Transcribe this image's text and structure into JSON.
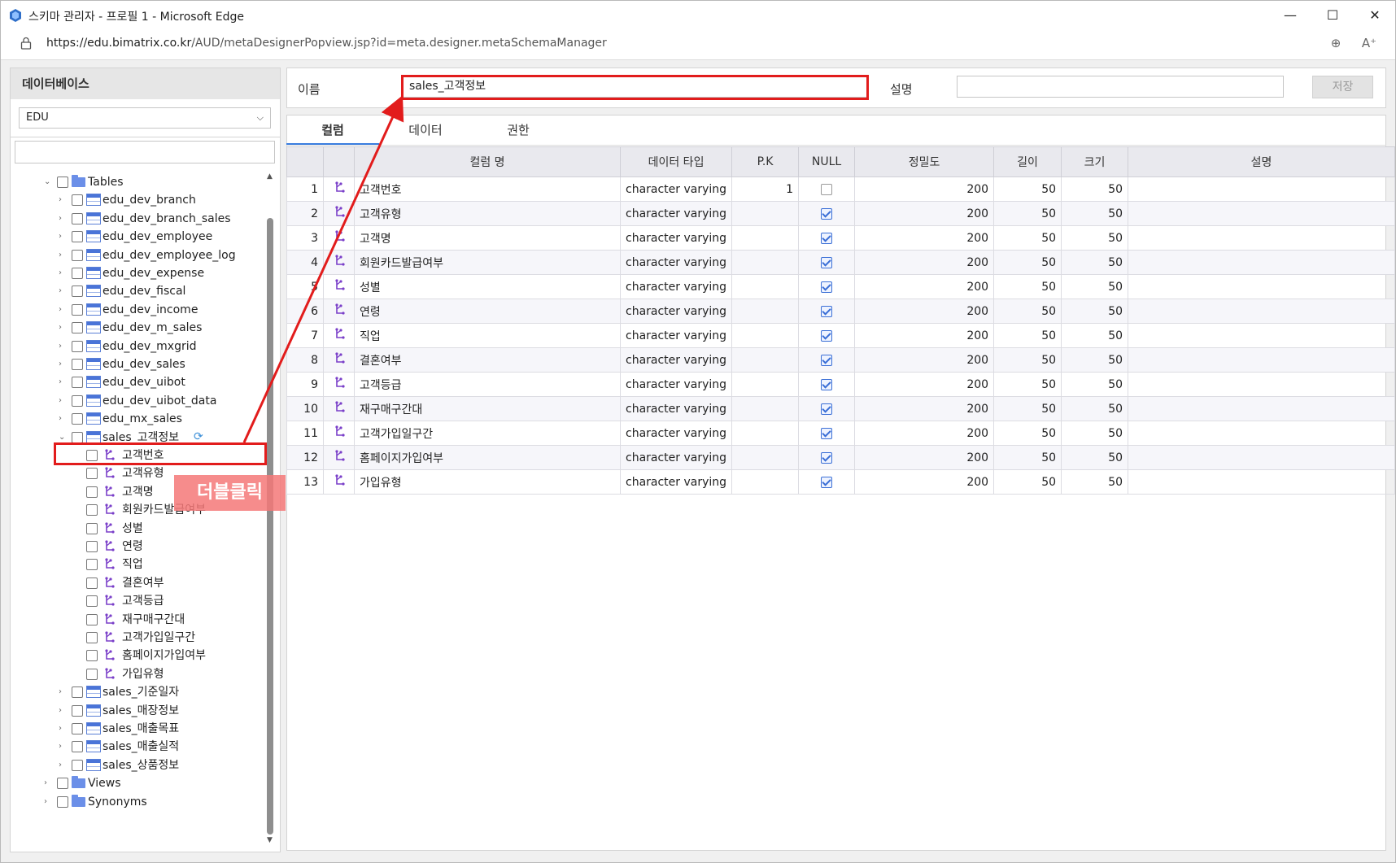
{
  "window": {
    "title": "스키마 관리자 - 프로필 1 - Microsoft Edge",
    "url_host": "https://edu.bimatrix.co.kr",
    "url_path": "/AUD/metaDesignerPopview.jsp?id=meta.designer.metaSchemaManager",
    "minimize_icon": "minimize-icon",
    "maximize_icon": "maximize-icon",
    "close_icon": "close-icon"
  },
  "left_panel": {
    "header": "데이터베이스",
    "db_selected": "EDU",
    "search_value": "",
    "tables_folder": "Tables",
    "tables": [
      "edu_dev_branch",
      "edu_dev_branch_sales",
      "edu_dev_employee",
      "edu_dev_employee_log",
      "edu_dev_expense",
      "edu_dev_fiscal",
      "edu_dev_income",
      "edu_dev_m_sales",
      "edu_dev_mxgrid",
      "edu_dev_sales",
      "edu_dev_uibot",
      "edu_dev_uibot_data",
      "edu_mx_sales"
    ],
    "selected_table": "sales_고객정보",
    "selected_columns": [
      "고객번호",
      "고객유형",
      "고객명",
      "회원카드발급여부",
      "성별",
      "연령",
      "직업",
      "결혼여부",
      "고객등급",
      "재구매구간대",
      "고객가입일구간",
      "홈페이지가입여부",
      "가입유형"
    ],
    "other_tables": [
      "sales_기준일자",
      "sales_매장정보",
      "sales_매출목표",
      "sales_매출실적",
      "sales_상품정보"
    ],
    "views_folder": "Views",
    "synonyms_folder": "Synonyms"
  },
  "form": {
    "name_label": "이름",
    "name_value": "sales_고객정보",
    "desc_label": "설명",
    "desc_value": "",
    "save_label": "저장"
  },
  "tabs": [
    "컬럼",
    "데이터",
    "권한"
  ],
  "active_tab": "컬럼",
  "grid": {
    "headers": [
      "",
      "",
      "컬럼 명",
      "데이터 타입",
      "P.K",
      "NULL",
      "정밀도",
      "길이",
      "크기",
      "설명"
    ],
    "rows": [
      {
        "no": "1",
        "name": "고객번호",
        "type": "character varying",
        "pk": "1",
        "null": false,
        "precision": "200",
        "length": "50",
        "size": "50",
        "desc": ""
      },
      {
        "no": "2",
        "name": "고객유형",
        "type": "character varying",
        "pk": "",
        "null": true,
        "precision": "200",
        "length": "50",
        "size": "50",
        "desc": ""
      },
      {
        "no": "3",
        "name": "고객명",
        "type": "character varying",
        "pk": "",
        "null": true,
        "precision": "200",
        "length": "50",
        "size": "50",
        "desc": ""
      },
      {
        "no": "4",
        "name": "회원카드발급여부",
        "type": "character varying",
        "pk": "",
        "null": true,
        "precision": "200",
        "length": "50",
        "size": "50",
        "desc": ""
      },
      {
        "no": "5",
        "name": "성별",
        "type": "character varying",
        "pk": "",
        "null": true,
        "precision": "200",
        "length": "50",
        "size": "50",
        "desc": ""
      },
      {
        "no": "6",
        "name": "연령",
        "type": "character varying",
        "pk": "",
        "null": true,
        "precision": "200",
        "length": "50",
        "size": "50",
        "desc": ""
      },
      {
        "no": "7",
        "name": "직업",
        "type": "character varying",
        "pk": "",
        "null": true,
        "precision": "200",
        "length": "50",
        "size": "50",
        "desc": ""
      },
      {
        "no": "8",
        "name": "결혼여부",
        "type": "character varying",
        "pk": "",
        "null": true,
        "precision": "200",
        "length": "50",
        "size": "50",
        "desc": ""
      },
      {
        "no": "9",
        "name": "고객등급",
        "type": "character varying",
        "pk": "",
        "null": true,
        "precision": "200",
        "length": "50",
        "size": "50",
        "desc": ""
      },
      {
        "no": "10",
        "name": "재구매구간대",
        "type": "character varying",
        "pk": "",
        "null": true,
        "precision": "200",
        "length": "50",
        "size": "50",
        "desc": ""
      },
      {
        "no": "11",
        "name": "고객가입일구간",
        "type": "character varying",
        "pk": "",
        "null": true,
        "precision": "200",
        "length": "50",
        "size": "50",
        "desc": ""
      },
      {
        "no": "12",
        "name": "홈페이지가입여부",
        "type": "character varying",
        "pk": "",
        "null": true,
        "precision": "200",
        "length": "50",
        "size": "50",
        "desc": ""
      },
      {
        "no": "13",
        "name": "가입유형",
        "type": "character varying",
        "pk": "",
        "null": true,
        "precision": "200",
        "length": "50",
        "size": "50",
        "desc": ""
      }
    ]
  },
  "annotation": {
    "label": "더블클릭",
    "color": "#e21c1c"
  }
}
